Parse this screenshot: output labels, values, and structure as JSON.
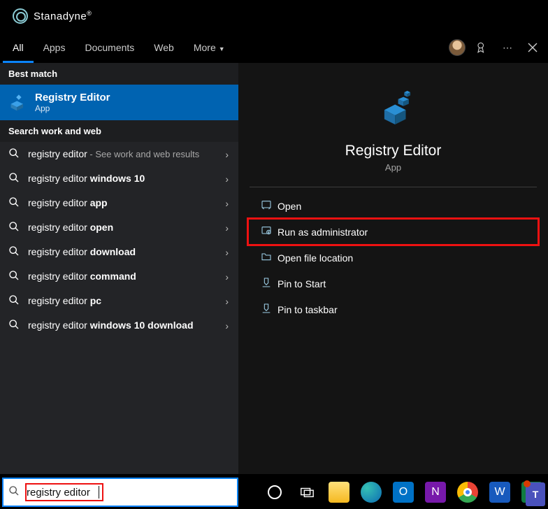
{
  "brand": {
    "name": "Stanadyne"
  },
  "tabs": {
    "items": [
      "All",
      "Apps",
      "Documents",
      "Web",
      "More"
    ],
    "active": 0
  },
  "left": {
    "best_match_header": "Best match",
    "best_match": {
      "title": "Registry Editor",
      "subtitle": "App"
    },
    "search_header": "Search work and web",
    "suggestions": [
      {
        "prefix": "registry editor",
        "bold": "",
        "suffix": " - See work and web results"
      },
      {
        "prefix": "registry editor ",
        "bold": "windows 10",
        "suffix": ""
      },
      {
        "prefix": "registry editor ",
        "bold": "app",
        "suffix": ""
      },
      {
        "prefix": "registry editor ",
        "bold": "open",
        "suffix": ""
      },
      {
        "prefix": "registry editor ",
        "bold": "download",
        "suffix": ""
      },
      {
        "prefix": "registry editor ",
        "bold": "command",
        "suffix": ""
      },
      {
        "prefix": "registry editor ",
        "bold": "pc",
        "suffix": ""
      },
      {
        "prefix": "registry editor ",
        "bold": "windows 10 download",
        "suffix": ""
      }
    ]
  },
  "pane": {
    "title": "Registry Editor",
    "subtitle": "App",
    "actions": [
      "Open",
      "Run as administrator",
      "Open file location",
      "Pin to Start",
      "Pin to taskbar"
    ],
    "highlight_index": 1
  },
  "search": {
    "value": "registry editor"
  },
  "taskbar_icons": [
    "cortana",
    "taskview",
    "explorer",
    "edge",
    "outlook",
    "onenote",
    "chrome",
    "word",
    "excel"
  ]
}
